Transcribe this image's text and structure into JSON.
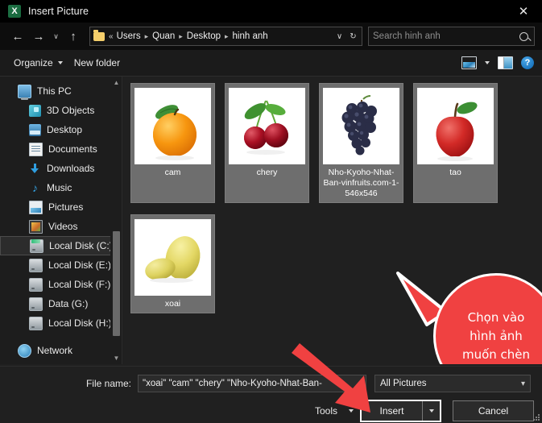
{
  "window": {
    "title": "Insert Picture",
    "app_icon": "excel-icon",
    "close_label": "✕"
  },
  "nav": {
    "back": "←",
    "forward": "→",
    "recent": "∨",
    "up": "↑",
    "breadcrumb": [
      "Users",
      "Quan",
      "Desktop",
      "hinh anh"
    ],
    "breadcrumb_prefix": "«",
    "dropdown": "∨",
    "refresh": "↻",
    "search_placeholder": "Search hinh anh"
  },
  "toolbar": {
    "organize": "Organize",
    "new_folder": "New folder",
    "view_icon": "extra-large-icons-icon",
    "pane_icon": "preview-pane-icon",
    "help": "?"
  },
  "sidebar": {
    "items": [
      {
        "label": "This PC",
        "icon": "computer-icon",
        "indent": false,
        "selected": false
      },
      {
        "label": "3D Objects",
        "icon": "cube-icon",
        "indent": true,
        "selected": false
      },
      {
        "label": "Desktop",
        "icon": "desktop-icon",
        "indent": true,
        "selected": false
      },
      {
        "label": "Documents",
        "icon": "documents-icon",
        "indent": true,
        "selected": false
      },
      {
        "label": "Downloads",
        "icon": "download-icon",
        "indent": true,
        "selected": false
      },
      {
        "label": "Music",
        "icon": "music-icon",
        "indent": true,
        "selected": false
      },
      {
        "label": "Pictures",
        "icon": "pictures-icon",
        "indent": true,
        "selected": false
      },
      {
        "label": "Videos",
        "icon": "videos-icon",
        "indent": true,
        "selected": false
      },
      {
        "label": "Local Disk (C:)",
        "icon": "drive-c-icon",
        "indent": true,
        "selected": true
      },
      {
        "label": "Local Disk (E:)",
        "icon": "drive-icon",
        "indent": true,
        "selected": false
      },
      {
        "label": "Local Disk (F:)",
        "icon": "drive-icon",
        "indent": true,
        "selected": false
      },
      {
        "label": "Data (G:)",
        "icon": "drive-icon",
        "indent": true,
        "selected": false
      },
      {
        "label": "Local Disk (H:)",
        "icon": "drive-icon",
        "indent": true,
        "selected": false
      },
      {
        "label": "Network",
        "icon": "network-icon",
        "indent": false,
        "selected": false
      }
    ]
  },
  "files": [
    {
      "name": "cam",
      "image": "orange",
      "selected": true
    },
    {
      "name": "chery",
      "image": "cherry",
      "selected": true
    },
    {
      "name": "Nho-Kyoho-Nhat-Ban-vinfruits.com-1-546x546",
      "image": "grapes",
      "selected": true
    },
    {
      "name": "tao",
      "image": "apple",
      "selected": true
    },
    {
      "name": "xoai",
      "image": "mango",
      "selected": true
    }
  ],
  "callout": {
    "lines": [
      "Chọn vào",
      "hình ảnh",
      "muốn chèn"
    ],
    "color": "#f04141"
  },
  "footer": {
    "file_name_label": "File name:",
    "file_name_value": "\"xoai\" \"cam\" \"chery\" \"Nho-Kyoho-Nhat-Ban-",
    "filter_value": "All Pictures",
    "tools_label": "Tools",
    "insert_label": "Insert",
    "cancel_label": "Cancel"
  },
  "colors": {
    "background": "#202020",
    "titlebar": "#000000",
    "accent_red": "#f04141",
    "selection": "#6e6e6e"
  }
}
